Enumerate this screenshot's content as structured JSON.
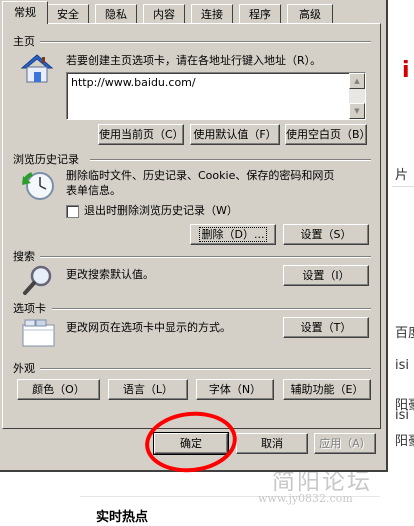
{
  "tabs": [
    {
      "label": "常规",
      "active": true
    },
    {
      "label": "安全"
    },
    {
      "label": "隐私"
    },
    {
      "label": "内容"
    },
    {
      "label": "连接"
    },
    {
      "label": "程序"
    },
    {
      "label": "高级"
    }
  ],
  "home": {
    "title": "主页",
    "description": "若要创建主页选项卡，请在各地址行键入地址（R）。",
    "url": "http://www.baidu.com/",
    "buttons": {
      "use_current": "使用当前页（C）",
      "use_default": "使用默认值（F）",
      "use_blank": "使用空白页（B）"
    }
  },
  "history": {
    "title": "浏览历史记录",
    "description_line1": "删除临时文件、历史记录、Cookie、保存的密码和网页",
    "description_line2": "表单信息。",
    "checkbox_label": "退出时删除浏览历史记录（W）",
    "buttons": {
      "delete": "删除（D）...",
      "settings": "设置（S）"
    }
  },
  "search": {
    "title": "搜索",
    "description": "更改搜索默认值。",
    "buttons": {
      "settings": "设置（I）"
    }
  },
  "tabs_section": {
    "title": "选项卡",
    "description": "更改网页在选项卡中显示的方式。",
    "buttons": {
      "settings": "设置（T）"
    }
  },
  "appearance": {
    "title": "外观",
    "buttons": {
      "colors": "颜色（O）",
      "languages": "语言（L）",
      "fonts": "字体（N）",
      "accessibility": "辅助功能（E）"
    }
  },
  "footer": {
    "ok": "确定",
    "cancel": "取消",
    "apply": "应用（A）"
  },
  "background": {
    "hot_title": "实时热点",
    "watermark": "简阳论坛",
    "watermark_url": "www.jy0832.com",
    "edge_snippets": [
      "i",
      "片",
      "百度",
      "isi",
      "阳豪",
      "isi",
      "阳豪"
    ]
  },
  "colors": {
    "dialog_face": "#d4d0c8",
    "annotation_circle": "#ff0000"
  }
}
